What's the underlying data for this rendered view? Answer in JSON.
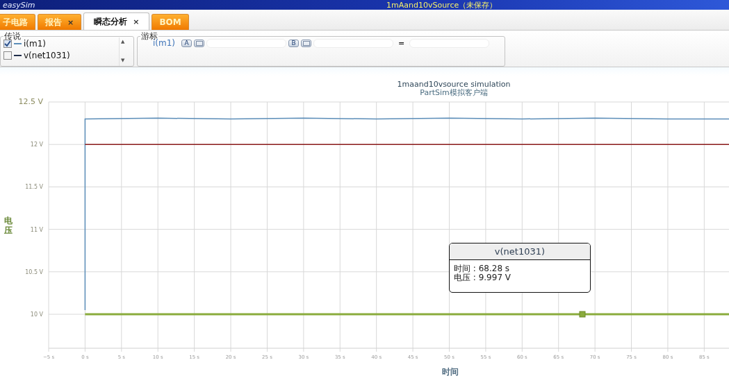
{
  "window": {
    "logo": "easySim",
    "title": "1mAand10vSource（未保存）"
  },
  "tabs": [
    {
      "label": "子电路",
      "selected": false
    },
    {
      "label": "报告",
      "selected": false,
      "close": "×"
    },
    {
      "label": "瞬态分析",
      "selected": true,
      "close": "×"
    },
    {
      "label": "BOM",
      "selected": false
    }
  ],
  "legend": {
    "title": "传说",
    "items": [
      {
        "label": "i(m1)",
        "checked": true,
        "color": "#5b8db8"
      },
      {
        "label": "v(net1031)",
        "checked": false,
        "color": "#1f2d4a"
      }
    ],
    "scroll_up": "▲",
    "scroll_down": "▼"
  },
  "cursor": {
    "title": "游标",
    "trace": "i(m1)",
    "button_a": "A",
    "button_b": "B",
    "equals": "="
  },
  "chart": {
    "tooltip": {
      "title": "v(net1031)",
      "lines": [
        "时间 : 68.28 s",
        "电压 : 9.997 V"
      ]
    },
    "chart_data": {
      "type": "line",
      "title": "1maand10vsource simulation",
      "subtitle": "PartSim模拟客户端",
      "xlabel": "时间",
      "ylabel": "电压",
      "x": [
        0,
        0,
        10,
        20,
        30,
        40,
        50,
        60,
        70,
        80,
        88.4
      ],
      "grid": true,
      "series": [
        {
          "color": "#5b8db8",
          "values": [
            10.05,
            12.3,
            12.31,
            12.3,
            12.31,
            12.3,
            12.31,
            12.3,
            12.31,
            12.3,
            12.3
          ]
        },
        {
          "color": "#8aab3c",
          "values": [
            10,
            10,
            10,
            10,
            10,
            10,
            10,
            10,
            10,
            10,
            10
          ]
        },
        {
          "color": "#8b1a1a",
          "values": [
            12,
            12,
            12,
            12,
            12,
            12,
            12,
            12,
            12,
            12,
            12
          ]
        }
      ],
      "xlim": [
        -5,
        88.4
      ],
      "ylim": [
        9.6,
        12.5
      ],
      "xticks": [
        {
          "value": -5,
          "label": "−5 s"
        },
        {
          "value": 0,
          "label": "0 s"
        },
        {
          "value": 5,
          "label": "5 s"
        },
        {
          "value": 10,
          "label": "10 s"
        },
        {
          "value": 15,
          "label": "15 s"
        },
        {
          "value": 20,
          "label": "20 s"
        },
        {
          "value": 25,
          "label": "25 s"
        },
        {
          "value": 30,
          "label": "30 s"
        },
        {
          "value": 35,
          "label": "35 s"
        },
        {
          "value": 40,
          "label": "40 s"
        },
        {
          "value": 45,
          "label": "45 s"
        },
        {
          "value": 50,
          "label": "50 s"
        },
        {
          "value": 55,
          "label": "55 s"
        },
        {
          "value": 60,
          "label": "60 s"
        },
        {
          "value": 65,
          "label": "65 s"
        },
        {
          "value": 70,
          "label": "70 s"
        },
        {
          "value": 75,
          "label": "75 s"
        },
        {
          "value": 80,
          "label": "80 s"
        },
        {
          "value": 85,
          "label": "85 s"
        }
      ],
      "yticks": [
        {
          "value": 10,
          "label": "10 V"
        },
        {
          "value": 10.5,
          "label": "10.5 V"
        },
        {
          "value": 11,
          "label": "11 V"
        },
        {
          "value": 11.5,
          "label": "11.5 V"
        },
        {
          "value": 12,
          "label": "12 V"
        },
        {
          "value": 12.5,
          "label": "12.5 V"
        }
      ]
    }
  }
}
